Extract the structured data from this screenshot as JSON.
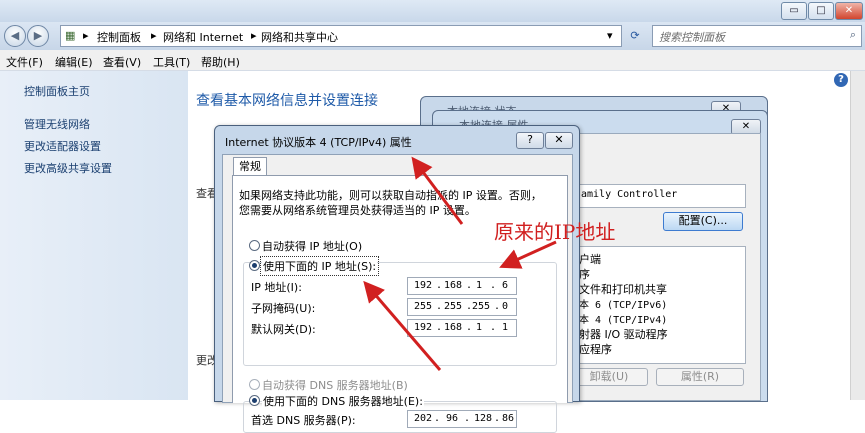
{
  "window": {
    "min_label": "▭",
    "max_label": "□",
    "close_label": "✕"
  },
  "address": {
    "crumbs": [
      "控制面板",
      "网络和 Internet",
      "网络和共享中心"
    ],
    "search_placeholder": "搜索控制面板"
  },
  "menu": [
    "文件(F)",
    "编辑(E)",
    "查看(V)",
    "工具(T)",
    "帮助(H)"
  ],
  "left_pane": {
    "home": "控制面板主页",
    "links": [
      "管理无线网络",
      "更改适配器设置",
      "更改高级共享设置"
    ]
  },
  "main": {
    "title": "查看基本网络信息并设置连接",
    "frag1": "查看",
    "frag2": "更改"
  },
  "back_dialog": {
    "title1": "本地连接 状态",
    "title2": "本地连接 属性",
    "adapter": "amily Controller",
    "configure": "配置(C)...",
    "items": [
      "户端",
      "序",
      "文件和打印机共享",
      "本 6 (TCP/IPv6)",
      "本 4 (TCP/IPv4)",
      "射器 I/O 驱动程序",
      "应程序"
    ],
    "uninstall": "卸载(U)",
    "properties": "属性(R)"
  },
  "dialog": {
    "title": "Internet 协议版本 4 (TCP/IPv4) 属性",
    "help_label": "?",
    "close_label": "✕",
    "tab": "常规",
    "desc_line1": "如果网络支持此功能，则可以获取自动指派的 IP 设置。否则，",
    "desc_line2": "您需要从网络系统管理员处获得适当的 IP 设置。",
    "auto_ip": "自动获得 IP 地址(O)",
    "manual_ip": "使用下面的 IP 地址(S):",
    "ip_label": "IP 地址(I):",
    "mask_label": "子网掩码(U):",
    "gw_label": "默认网关(D):",
    "ip": [
      "192",
      "168",
      "1",
      "6"
    ],
    "mask": [
      "255",
      "255",
      "255",
      "0"
    ],
    "gateway": [
      "192",
      "168",
      "1",
      "1"
    ],
    "auto_dns": "自动获得 DNS 服务器地址(B)",
    "manual_dns": "使用下面的 DNS 服务器地址(E):",
    "dns1_label": "首选 DNS 服务器(P):",
    "dns1": [
      "202",
      "96",
      "128",
      "86"
    ]
  },
  "annotation": {
    "text": "原来的IP地址",
    "color": "#d12020"
  }
}
